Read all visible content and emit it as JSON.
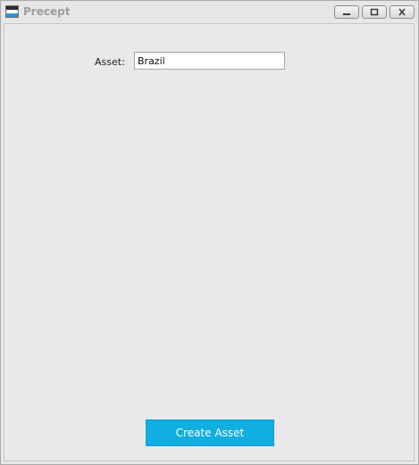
{
  "window": {
    "title": "Precept",
    "controls": [
      "minimize",
      "maximize",
      "close"
    ]
  },
  "form": {
    "asset_label": "Asset:",
    "asset_value": "Brazil"
  },
  "actions": {
    "create_label": "Create Asset"
  },
  "colors": {
    "accent": "#10aee1",
    "background": "#e9e9e9"
  }
}
